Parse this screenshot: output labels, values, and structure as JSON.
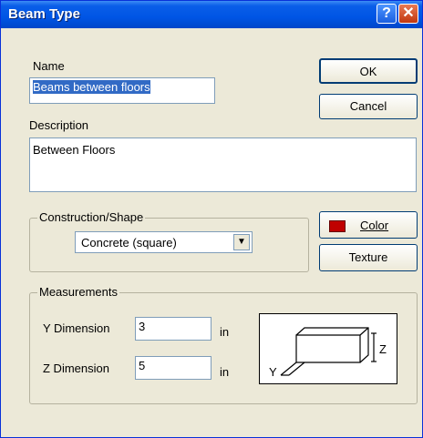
{
  "window": {
    "title": "Beam Type"
  },
  "titlebar": {
    "help_glyph": "?",
    "close_glyph": "✕",
    "help_icon": "help-icon",
    "close_icon": "close-icon"
  },
  "name": {
    "label": "Name",
    "value": "Beams between floors"
  },
  "description": {
    "label": "Description",
    "value": "Between Floors"
  },
  "buttons": {
    "ok": "OK",
    "cancel": "Cancel",
    "color": "Color",
    "texture": "Texture"
  },
  "construction": {
    "label": "Construction/Shape",
    "selected": "Concrete (square)"
  },
  "measurements": {
    "label": "Measurements",
    "y_label": "Y Dimension",
    "y_value": "3",
    "y_unit": "in",
    "z_label": "Z Dimension",
    "z_value": "5",
    "z_unit": "in"
  },
  "diagram": {
    "y_axis": "Y",
    "z_axis": "Z"
  },
  "colors": {
    "swatch": "#c00000",
    "title_bar": "#0055e5",
    "selection": "#316ac5"
  }
}
